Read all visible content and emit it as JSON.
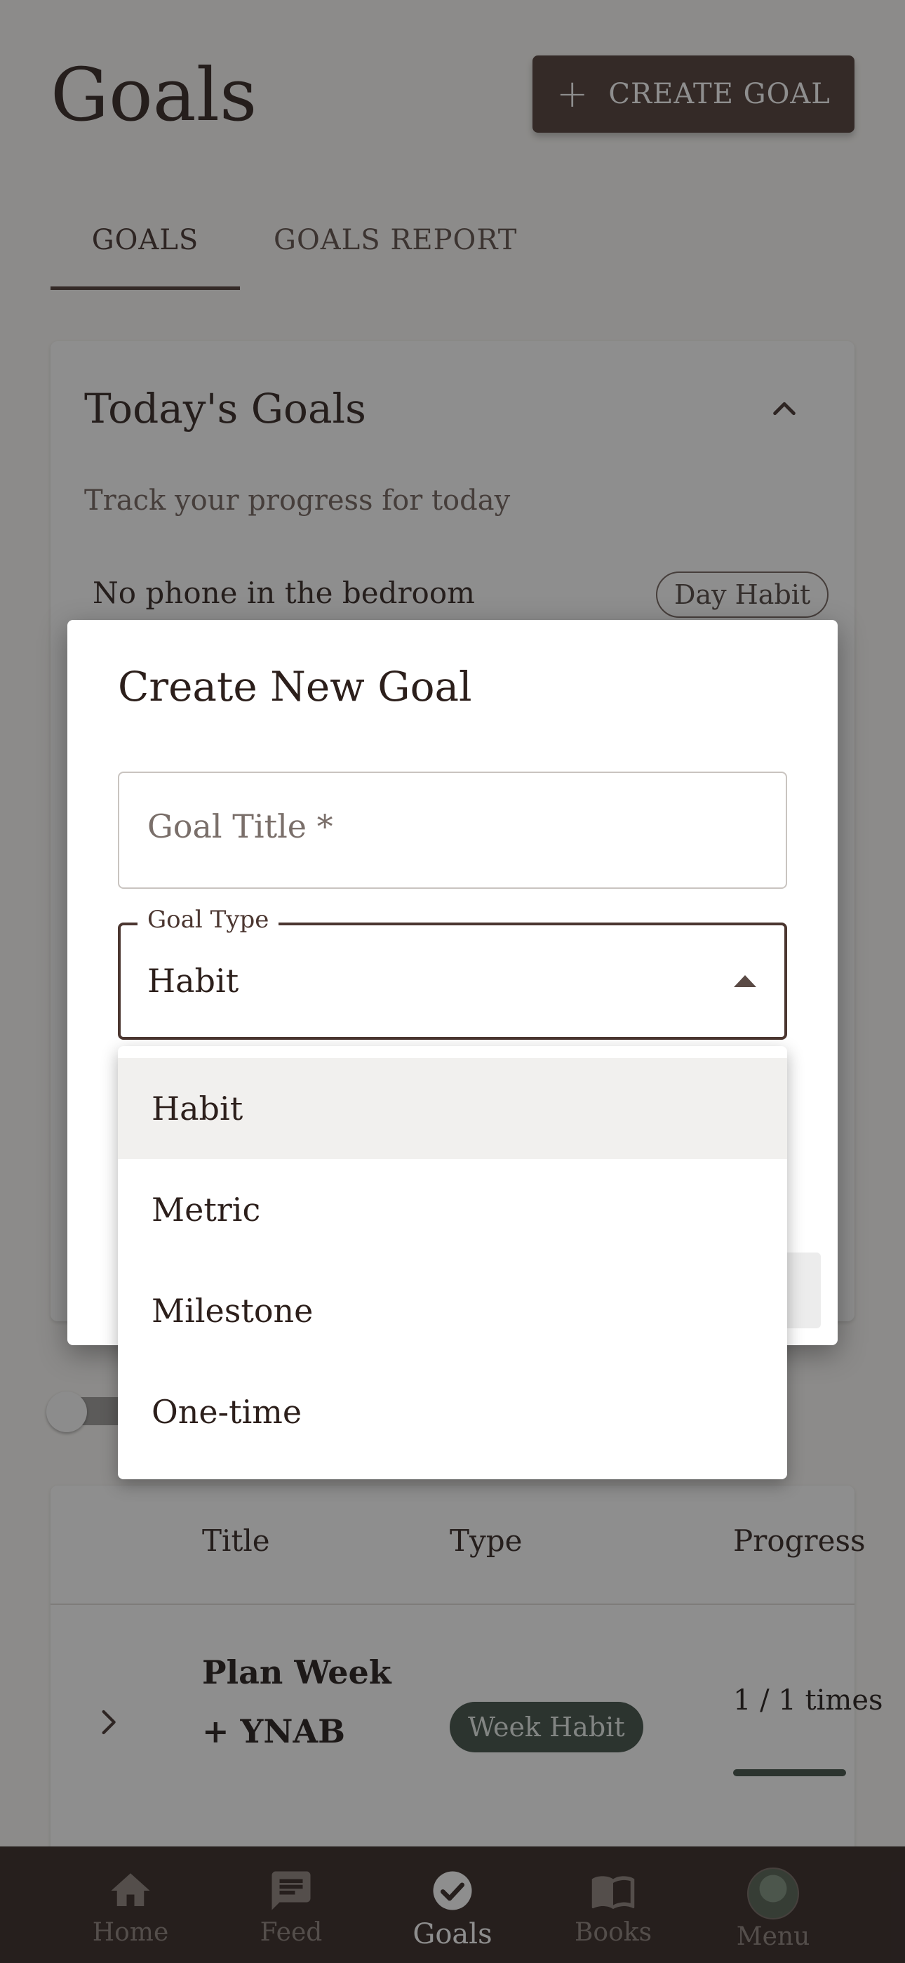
{
  "header": {
    "title": "Goals",
    "create_button_label": "CREATE GOAL"
  },
  "tabs": [
    {
      "label": "GOALS",
      "active": true
    },
    {
      "label": "GOALS REPORT",
      "active": false
    }
  ],
  "today_card": {
    "title": "Today's Goals",
    "subtitle": "Track your progress for today",
    "goal": {
      "title": "No phone in the bedroom",
      "type": "Day Habit"
    }
  },
  "table": {
    "columns": [
      "Title",
      "Type",
      "Progress"
    ],
    "rows": [
      {
        "title": "Plan Week + YNAB",
        "type": "Week Habit",
        "progress": "1 / 1 times",
        "progress_fraction": 1.0
      }
    ]
  },
  "bottom_nav": [
    {
      "label": "Home",
      "icon": "home-icon",
      "active": false
    },
    {
      "label": "Feed",
      "icon": "chat-icon",
      "active": false
    },
    {
      "label": "Goals",
      "icon": "check-circle-icon",
      "active": true
    },
    {
      "label": "Books",
      "icon": "book-icon",
      "active": false
    },
    {
      "label": "Menu",
      "icon": "avatar",
      "active": false
    }
  ],
  "dialog": {
    "title": "Create New Goal",
    "goal_title_placeholder": "Goal Title *",
    "goal_type_label": "Goal Type",
    "goal_type_value": "Habit",
    "goal_type_options": [
      "Habit",
      "Metric",
      "Milestone",
      "One-time"
    ]
  },
  "colors": {
    "primary": "#4b3630",
    "nav_background": "#2e211d",
    "chip_green": "#3a4a40"
  }
}
